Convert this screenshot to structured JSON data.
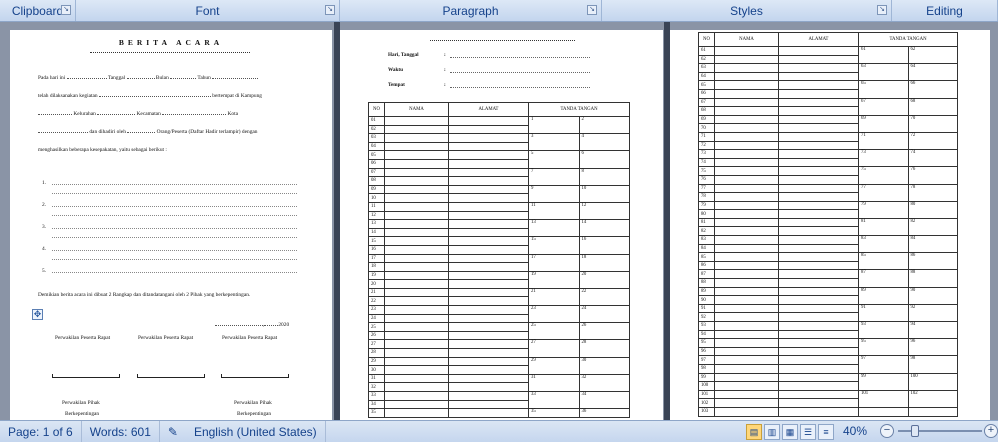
{
  "ribbon": {
    "groups": [
      {
        "label": "Clipboard",
        "launcher": true
      },
      {
        "label": "Font",
        "launcher": true
      },
      {
        "label": "Paragraph",
        "launcher": true
      },
      {
        "label": "Styles",
        "launcher": true
      },
      {
        "label": "Editing",
        "launcher": false
      }
    ]
  },
  "page1": {
    "title": "BERITA ACARA",
    "line1_a": "Pada hari ini",
    "line1_b": "Tanggal",
    "line1_c": "Bulan",
    "line1_d": "Tahun",
    "line2_a": "telah dilaksanakan kegiatan",
    "line2_b": "bertempat di Kampung",
    "line3_a": "Kelurahan",
    "line3_b": "Kecamatan",
    "line3_c": "Kota",
    "line4_a": "dan dihadiri oleh",
    "line4_b": "Orang/Peserta (Daftar Hadir terlampir) dengan",
    "line5": "menghasilkan beberapa kesepakatan, yaitu sebagai berikut :",
    "numbers": [
      "1.",
      "2.",
      "3.",
      "4.",
      "5."
    ],
    "closing": "Demikian berita acara ini dibuat 2 Rangkap dan ditandatangani oleh 2 Pihak yang berkepentingan.",
    "date_suffix": "2020",
    "reps": [
      "Perwakilan Peserta Rapat",
      "Perwakilan Peserta Rapat",
      "Perwakilan Peserta Rapat"
    ],
    "party_left": [
      "Perwakilan Pihak",
      "Berkepentingan"
    ],
    "party_right": [
      "Perwakilan Pihak",
      "Berkepentingan"
    ]
  },
  "page2": {
    "fields": [
      "Hari, Tanggal",
      "Waktu",
      "Tempat"
    ],
    "colon": ":",
    "headers": [
      "NO",
      "NAMA",
      "ALAMAT",
      "TANDA TANGAN"
    ],
    "rows": [
      "01",
      "02",
      "03",
      "04",
      "05",
      "06",
      "07",
      "08",
      "09",
      "10",
      "11",
      "12",
      "13",
      "14",
      "15",
      "16",
      "17",
      "18",
      "19",
      "20",
      "21",
      "22",
      "23",
      "24",
      "25",
      "26",
      "27",
      "28",
      "29",
      "30",
      "31",
      "32",
      "33",
      "34",
      "35"
    ],
    "sig_pairs": [
      [
        "1",
        "2"
      ],
      [
        "3",
        "4"
      ],
      [
        "5",
        "6"
      ],
      [
        "7",
        "8"
      ],
      [
        "9",
        "10"
      ],
      [
        "11",
        "12"
      ],
      [
        "13",
        "14"
      ],
      [
        "15",
        "16"
      ],
      [
        "17",
        "18"
      ],
      [
        "19",
        "20"
      ],
      [
        "21",
        "22"
      ],
      [
        "23",
        "24"
      ],
      [
        "25",
        "26"
      ],
      [
        "27",
        "28"
      ],
      [
        "29",
        "30"
      ],
      [
        "31",
        "32"
      ],
      [
        "33",
        "34"
      ],
      [
        "35",
        "36"
      ]
    ]
  },
  "page3": {
    "headers": [
      "NO",
      "NAMA",
      "ALAMAT",
      "TANDA TANGAN"
    ],
    "rows": [
      "61",
      "62",
      "63",
      "64",
      "65",
      "66",
      "67",
      "68",
      "69",
      "70",
      "71",
      "72",
      "73",
      "74",
      "75",
      "76",
      "77",
      "78",
      "79",
      "80",
      "81",
      "82",
      "83",
      "84",
      "85",
      "86",
      "87",
      "88",
      "89",
      "90",
      "91",
      "92",
      "93",
      "94",
      "95",
      "96",
      "97",
      "98",
      "99",
      "100",
      "101",
      "102",
      "103"
    ],
    "sig_pairs": [
      [
        "61",
        "62"
      ],
      [
        "63",
        "64"
      ],
      [
        "65",
        "66"
      ],
      [
        "67",
        "68"
      ],
      [
        "69",
        "70"
      ],
      [
        "71",
        "72"
      ],
      [
        "73",
        "74"
      ],
      [
        "75",
        "76"
      ],
      [
        "77",
        "78"
      ],
      [
        "79",
        "80"
      ],
      [
        "81",
        "82"
      ],
      [
        "83",
        "84"
      ],
      [
        "85",
        "86"
      ],
      [
        "87",
        "88"
      ],
      [
        "89",
        "90"
      ],
      [
        "91",
        "92"
      ],
      [
        "93",
        "94"
      ],
      [
        "95",
        "96"
      ],
      [
        "97",
        "98"
      ],
      [
        "99",
        "100"
      ],
      [
        "101",
        "102"
      ]
    ]
  },
  "status": {
    "page": "Page: 1 of 6",
    "words": "Words: 601",
    "language": "English (United States)",
    "zoom": "40%",
    "zoom_minus": "−",
    "zoom_plus": "+"
  }
}
